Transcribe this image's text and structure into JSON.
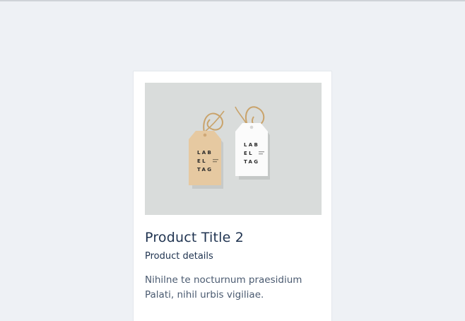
{
  "card": {
    "image_alt": "Product image of two hanging label tags",
    "image_tags": [
      {
        "lines": [
          "LAB",
          "EL",
          "TAG"
        ]
      },
      {
        "lines": [
          "LAB",
          "EL",
          "TAG"
        ]
      }
    ],
    "title": "Product Title 2",
    "subtitle": "Product details",
    "description": "Nihilne te nocturnum praesidium Palati, nihil urbis vigiliae."
  },
  "colors": {
    "page_background": "#eef1f5",
    "card_background": "#ffffff",
    "title": "#1f3350",
    "body_text": "#4a5a70",
    "kraft_tag": "#e6c9a1",
    "white_tag": "#fbfbfb",
    "photo_background": "#d9dcdb"
  }
}
